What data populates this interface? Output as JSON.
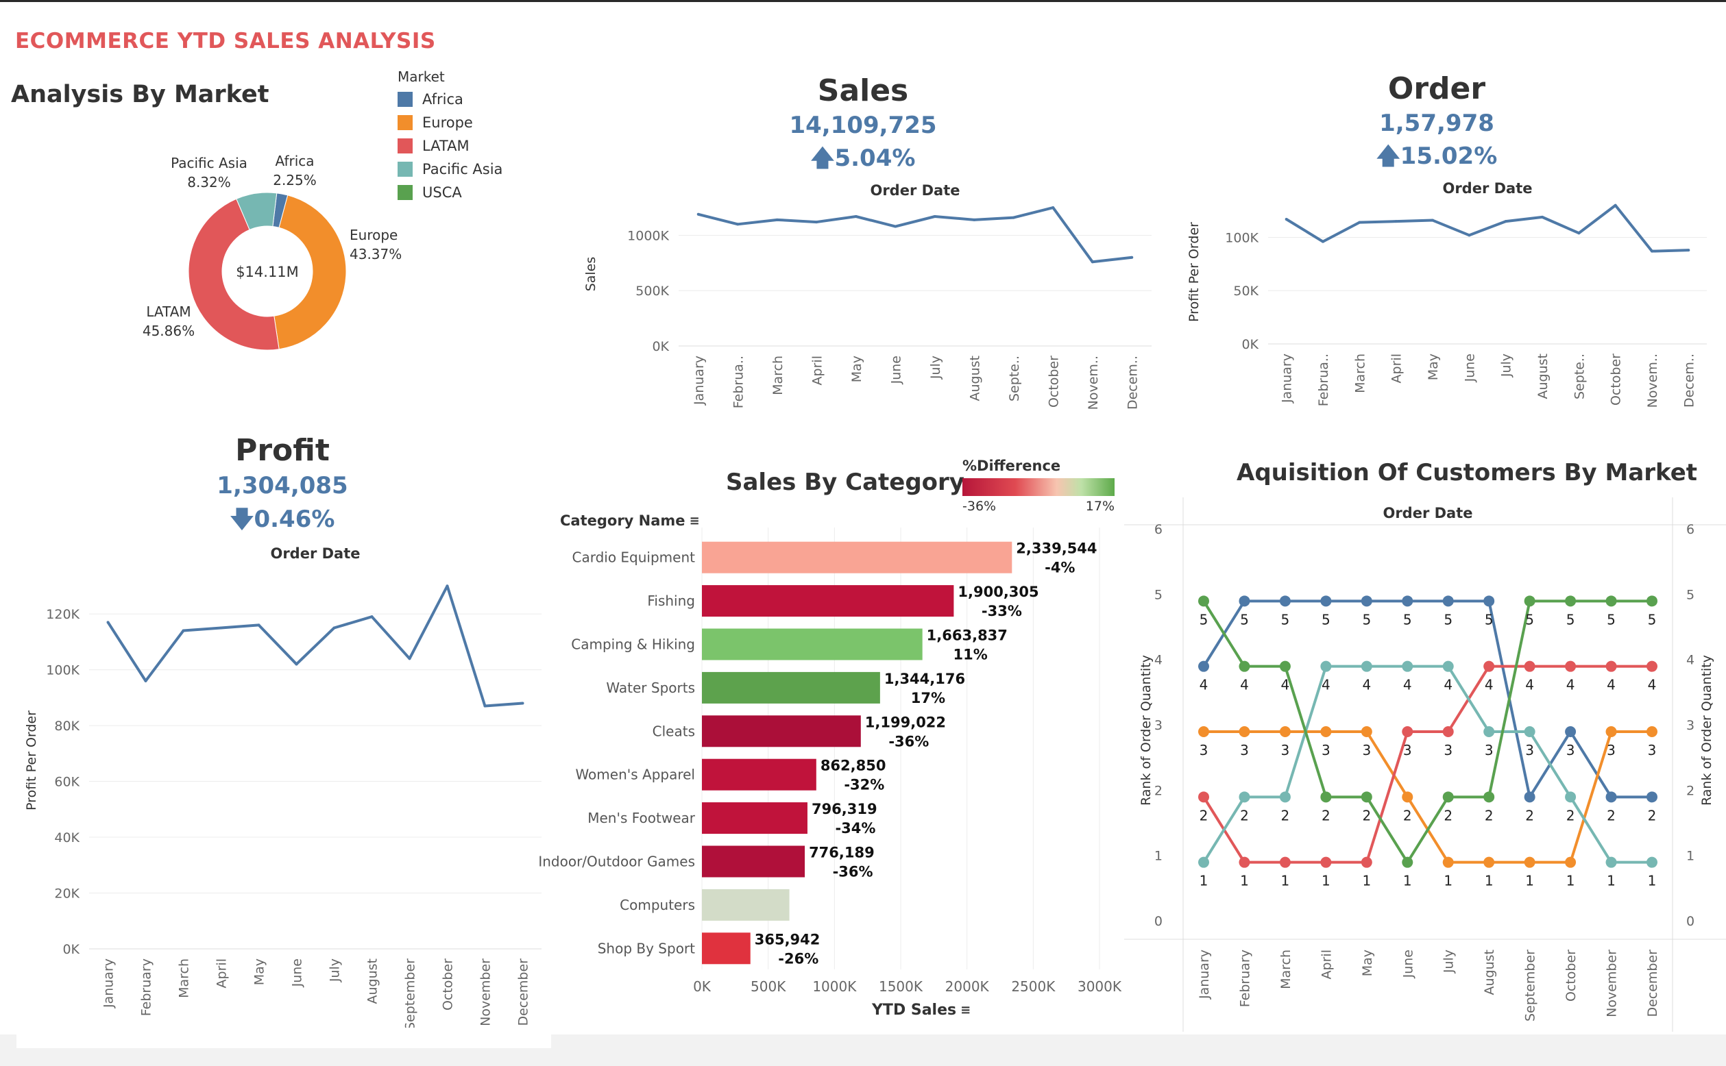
{
  "dashboard_title": "ECOMMERCE YTD SALES ANALYSIS",
  "market": {
    "title": "Analysis By Market",
    "legend_title": "Market",
    "center_label": "$14.11M",
    "segments": [
      {
        "name": "Africa",
        "pct_label": "2.25%",
        "value": 2.25,
        "color": "#4e79a7"
      },
      {
        "name": "Europe",
        "pct_label": "43.37%",
        "value": 43.37,
        "color": "#f28e2b"
      },
      {
        "name": "LATAM",
        "pct_label": "45.86%",
        "value": 45.86,
        "color": "#e15759"
      },
      {
        "name": "Pacific Asia",
        "pct_label": "8.32%",
        "value": 8.32,
        "color": "#76b7b2"
      },
      {
        "name": "USCA",
        "pct_label": "",
        "value": 0,
        "color": "#59a14f"
      }
    ]
  },
  "sales": {
    "title": "Sales",
    "value": "14,109,725",
    "change": "5.04%",
    "change_arrow": "up",
    "chart_title": "Order Date",
    "y_label": "Sales"
  },
  "order": {
    "title": "Order",
    "value": "1,57,978",
    "change": "15.02%",
    "change_arrow": "up",
    "chart_title": "Order Date",
    "y_label": "Profit Per Order"
  },
  "profit": {
    "title": "Profit",
    "value": "1,304,085",
    "change": "0.46%",
    "change_arrow": "down",
    "chart_title": "Order Date",
    "y_label": "Profit Per Order"
  },
  "category": {
    "title": "Sales By Category",
    "header": "Category Name",
    "x_title": "YTD Sales",
    "legend_title": "%Difference",
    "legend_min": "-36%",
    "legend_max": "17%"
  },
  "acquisition": {
    "title": "Aquisition Of Customers By Market",
    "chart_title": "Order Date",
    "y_label": "Rank of Order Quantity"
  },
  "chart_data": [
    {
      "type": "pie",
      "title": "Analysis By Market",
      "categories": [
        "Africa",
        "Europe",
        "LATAM",
        "Pacific Asia"
      ],
      "values": [
        2.25,
        43.37,
        45.86,
        8.32
      ],
      "center": "$14.11M"
    },
    {
      "type": "line",
      "title": "Sales",
      "xlabel": "Order Date",
      "ylabel": "Sales",
      "x": [
        "January",
        "Februa..",
        "March",
        "April",
        "May",
        "June",
        "July",
        "August",
        "Septe..",
        "October",
        "Novem..",
        "Decem.."
      ],
      "y_ticks": [
        "0K",
        "500K",
        "1000K"
      ],
      "ylim": [
        0,
        1300000
      ],
      "values": [
        1190000,
        1100000,
        1140000,
        1120000,
        1170000,
        1080000,
        1170000,
        1140000,
        1160000,
        1250000,
        760000,
        800000
      ]
    },
    {
      "type": "line",
      "title": "Order",
      "xlabel": "Order Date",
      "ylabel": "Profit Per Order",
      "x": [
        "January",
        "Februa..",
        "March",
        "April",
        "May",
        "June",
        "July",
        "August",
        "Septe..",
        "October",
        "Novem..",
        "Decem.."
      ],
      "y_ticks": [
        "0K",
        "50K",
        "100K"
      ],
      "ylim": [
        0,
        135000
      ],
      "values": [
        117000,
        96000,
        114000,
        115000,
        116000,
        102000,
        115000,
        119000,
        104000,
        130000,
        87000,
        88000
      ]
    },
    {
      "type": "line",
      "title": "Profit",
      "xlabel": "Order Date",
      "ylabel": "Profit Per Order",
      "x": [
        "January",
        "February",
        "March",
        "April",
        "May",
        "June",
        "July",
        "August",
        "September",
        "October",
        "November",
        "December"
      ],
      "y_ticks": [
        "0K",
        "20K",
        "40K",
        "60K",
        "80K",
        "100K",
        "120K"
      ],
      "ylim": [
        0,
        135000
      ],
      "values": [
        117000,
        96000,
        114000,
        115000,
        116000,
        102000,
        115000,
        119000,
        104000,
        130000,
        87000,
        88000
      ]
    },
    {
      "type": "bar",
      "title": "Sales By Category",
      "xlabel": "YTD Sales",
      "ylabel": "Category Name",
      "x_ticks": [
        "0K",
        "500K",
        "1000K",
        "1500K",
        "2000K",
        "2500K",
        "3000K"
      ],
      "xlim": [
        0,
        3000000
      ],
      "categories": [
        "Cardio Equipment",
        "Fishing",
        "Camping & Hiking",
        "Water Sports",
        "Cleats",
        "Women's Apparel",
        "Men's Footwear",
        "Indoor/Outdoor Games",
        "Computers",
        "Shop By Sport"
      ],
      "values": [
        2339544,
        1900305,
        1663837,
        1344176,
        1199022,
        862850,
        796319,
        776189,
        660000,
        365942
      ],
      "value_labels": [
        "2,339,544",
        "1,900,305",
        "1,663,837",
        "1,344,176",
        "1,199,022",
        "862,850",
        "796,319",
        "776,189",
        "",
        "365,942"
      ],
      "pct_labels": [
        "-4%",
        "-33%",
        "11%",
        "17%",
        "-36%",
        "-32%",
        "-34%",
        "-36%",
        "",
        "-26%"
      ],
      "colors": [
        "#f9a494",
        "#c0133b",
        "#7bc46b",
        "#5da24d",
        "#ab0f39",
        "#c0133b",
        "#c0133b",
        "#b0103a",
        "#d3dcc8",
        "#e0323e"
      ]
    },
    {
      "type": "line",
      "title": "Aquisition Of Customers By Market",
      "xlabel": "Order Date",
      "ylabel": "Rank of Order Quantity",
      "x": [
        "January",
        "February",
        "March",
        "April",
        "May",
        "June",
        "July",
        "August",
        "September",
        "October",
        "November",
        "December"
      ],
      "y_ticks": [
        "0",
        "1",
        "2",
        "3",
        "4",
        "5",
        "6"
      ],
      "ylim": [
        0,
        6
      ],
      "series": [
        {
          "name": "Africa",
          "color": "#4e79a7",
          "values": [
            4,
            5,
            5,
            5,
            5,
            5,
            5,
            5,
            2,
            3,
            2,
            2
          ]
        },
        {
          "name": "Europe",
          "color": "#f28e2b",
          "values": [
            3,
            3,
            3,
            3,
            3,
            2,
            1,
            1,
            1,
            1,
            3,
            3
          ]
        },
        {
          "name": "LATAM",
          "color": "#e15759",
          "values": [
            2,
            1,
            1,
            1,
            1,
            3,
            3,
            4,
            4,
            4,
            4,
            4
          ]
        },
        {
          "name": "Pacific Asia",
          "color": "#76b7b2",
          "values": [
            1,
            2,
            2,
            4,
            4,
            4,
            4,
            3,
            3,
            2,
            1,
            1
          ]
        },
        {
          "name": "USCA",
          "color": "#59a14f",
          "values": [
            5,
            4,
            4,
            2,
            2,
            1,
            2,
            2,
            5,
            5,
            5,
            5
          ]
        }
      ]
    }
  ]
}
